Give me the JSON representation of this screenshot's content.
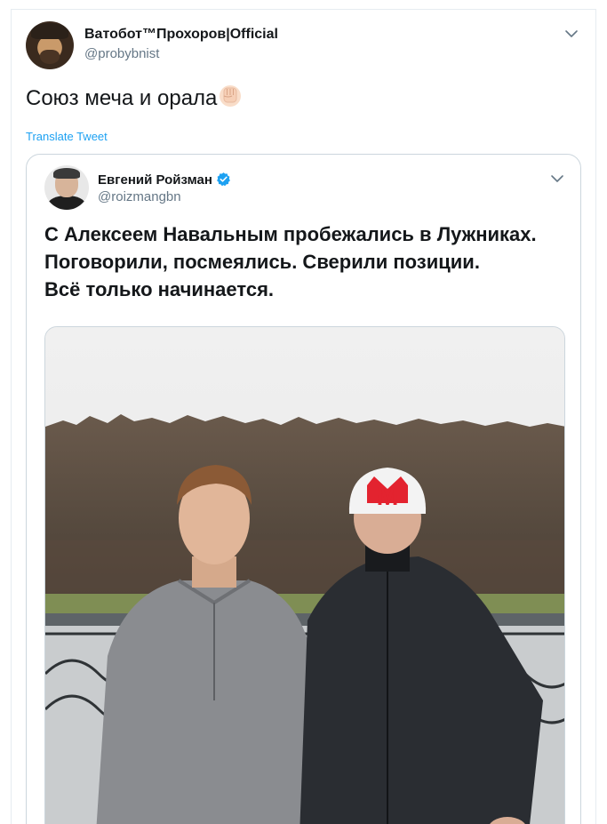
{
  "tweet": {
    "display_name": "Ватобот™Прохоров|Official",
    "handle": "@probybnist",
    "text": "Союз меча и орала",
    "translate_label": "Translate Tweet",
    "avatar_icon": "user-avatar",
    "chevron_icon": "chevron-down-icon",
    "emoji_icon": "raised-fist-emoji"
  },
  "quoted": {
    "display_name": "Евгений Ройзман",
    "handle": "@roizmangbn",
    "verified_icon": "verified-badge-icon",
    "text_lines": [
      "С Алексеем Навальным пробежались в Лужниках.",
      "Поговорили, посмеялись. Сверили позиции.",
      "Всё только начинается."
    ],
    "photo_label": "two men in running gear outdoors",
    "cap_letter": "M"
  },
  "colors": {
    "link": "#1da1f2",
    "secondary_text": "#657786",
    "border": "#ccd6dd",
    "verified": "#1da1f2",
    "cap_logo": "#e3232f"
  }
}
